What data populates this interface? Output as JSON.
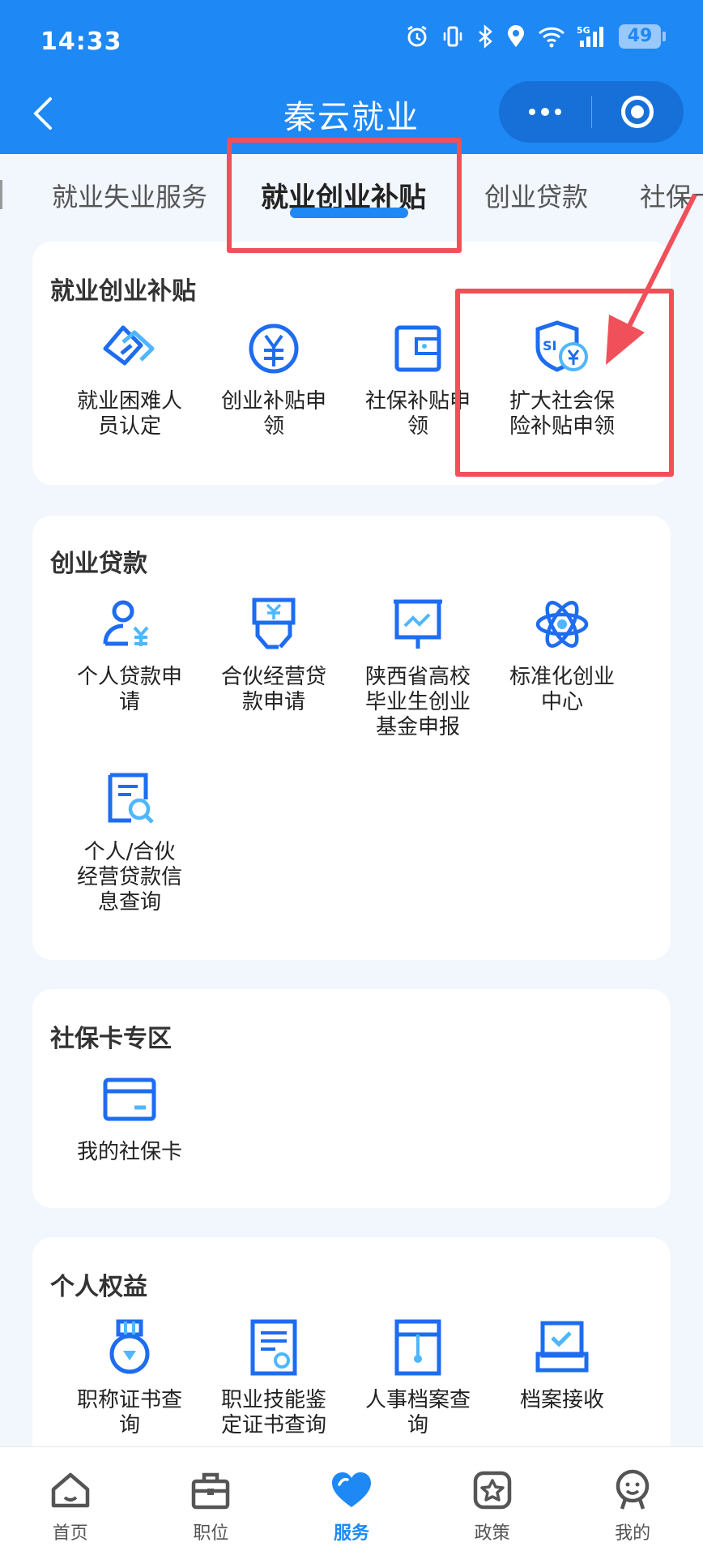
{
  "status_bar": {
    "time": "14:33",
    "battery": "49",
    "network": "5G"
  },
  "header": {
    "title": "秦云就业"
  },
  "tabs": [
    {
      "label": "就业失业服务",
      "active": false
    },
    {
      "label": "就业创业补贴",
      "active": true
    },
    {
      "label": "创业贷款",
      "active": false
    },
    {
      "label": "社保卡",
      "active": false
    }
  ],
  "sections": [
    {
      "title": "就业创业补贴",
      "items": [
        {
          "label": "就业困难人员认定",
          "icon": "handshake-icon"
        },
        {
          "label": "创业补贴申领",
          "icon": "yuan-coin-icon"
        },
        {
          "label": "社保补贴申领",
          "icon": "wallet-icon"
        },
        {
          "label": "扩大社会保险补贴申领",
          "icon": "si-shield-icon"
        }
      ]
    },
    {
      "title": "创业贷款",
      "items": [
        {
          "label": "个人贷款申请",
          "icon": "person-yuan-icon"
        },
        {
          "label": "合伙经营贷款申请",
          "icon": "hand-yuan-icon"
        },
        {
          "label": "陕西省高校毕业生创业基金申报",
          "icon": "presentation-chart-icon"
        },
        {
          "label": "标准化创业中心",
          "icon": "atom-icon"
        },
        {
          "label": "个人/合伙经营贷款信息查询",
          "icon": "document-search-icon"
        }
      ]
    },
    {
      "title": "社保卡专区",
      "items": [
        {
          "label": "我的社保卡",
          "icon": "card-icon"
        }
      ]
    },
    {
      "title": "个人权益",
      "items": [
        {
          "label": "职称证书查询",
          "icon": "medal-icon"
        },
        {
          "label": "职业技能鉴定证书查询",
          "icon": "certificate-icon"
        },
        {
          "label": "人事档案查询",
          "icon": "archive-folder-icon"
        },
        {
          "label": "档案接收",
          "icon": "archive-box-icon"
        }
      ]
    }
  ],
  "bottom_nav": [
    {
      "label": "首页",
      "icon": "home-icon",
      "active": false
    },
    {
      "label": "职位",
      "icon": "briefcase-icon",
      "active": false
    },
    {
      "label": "服务",
      "icon": "heart-icon",
      "active": true
    },
    {
      "label": "政策",
      "icon": "star-badge-icon",
      "active": false
    },
    {
      "label": "我的",
      "icon": "profile-face-icon",
      "active": false
    }
  ],
  "colors": {
    "primary": "#1e88f5",
    "highlight": "#f0505a",
    "background": "#f2f6fd"
  }
}
